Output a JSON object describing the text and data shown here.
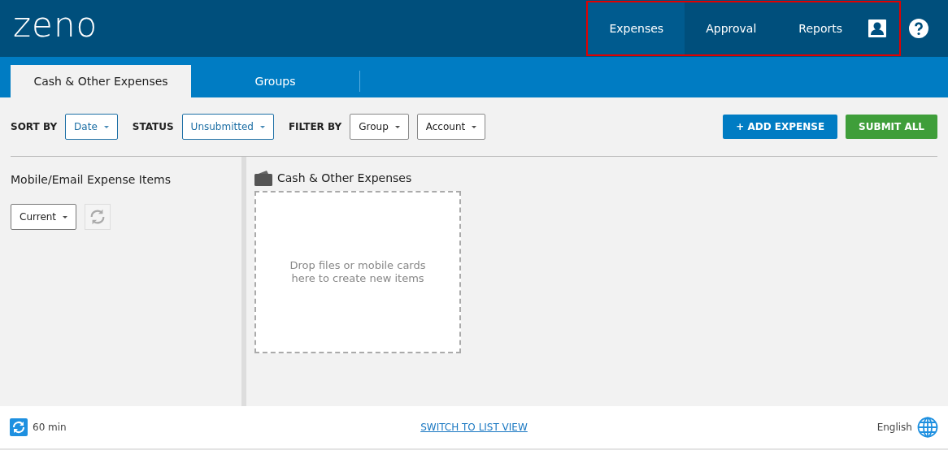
{
  "header": {
    "logo": "zeno",
    "nav": [
      {
        "label": "Expenses",
        "selected": true
      },
      {
        "label": "Approval",
        "selected": false
      },
      {
        "label": "Reports",
        "selected": false
      }
    ],
    "highlighted": true
  },
  "tabs": [
    {
      "label": "Cash & Other Expenses",
      "selected": true
    },
    {
      "label": "Groups",
      "selected": false
    }
  ],
  "toolbar": {
    "filters": [
      {
        "label": "SORT BY",
        "value": "Date",
        "active": true
      },
      {
        "label": "STATUS",
        "value": "Unsubmitted",
        "active": true
      },
      {
        "label": "FILTER BY",
        "value": "Group",
        "active": false
      },
      {
        "value": "Account",
        "active": false
      }
    ],
    "buttons": [
      {
        "label": "+ ADD EXPENSE",
        "kind": "primary"
      },
      {
        "label": "SUBMIT ALL",
        "kind": "success"
      }
    ]
  },
  "left_panel": {
    "title": "Mobile/Email Expense Items",
    "dropdown": "Current"
  },
  "main_panel": {
    "title": "Cash & Other Expenses",
    "dropzone": "Drop files or mobile cards here to create new items"
  },
  "footer": {
    "refresh": "60 min",
    "link": "SWITCH TO LIST VIEW",
    "language": "English"
  }
}
